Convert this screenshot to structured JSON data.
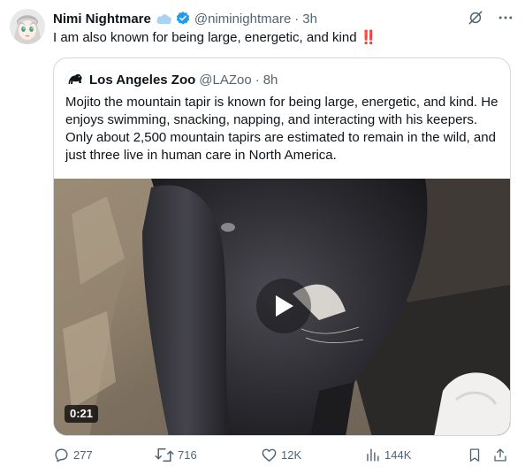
{
  "tweet": {
    "author_name": "Nimi Nightmare",
    "author_handle": "@niminightmare",
    "separator": "·",
    "time": "3h",
    "text": "I am also known for being large, energetic, and kind",
    "emoji": "‼️",
    "icons": {
      "badge": "cloud-icon",
      "verified": "verified-badge-icon",
      "menu": "more-icon",
      "grok": "grok-icon"
    }
  },
  "quote": {
    "author_name": "Los Angeles Zoo",
    "author_handle": "@LAZoo",
    "separator": "·",
    "time": "8h",
    "text": "Mojito the mountain tapir is known for being large, energetic, and kind. He enjoys swimming, snacking, napping, and interacting with his keepers. Only about 2,500 mountain tapirs are estimated to remain in the wild, and just three live in human care in North America.",
    "video": {
      "duration": "0:21"
    }
  },
  "actions": {
    "replies": "277",
    "reposts": "716",
    "likes": "12K",
    "views": "144K"
  },
  "colors": {
    "accent": "#1d9bf0",
    "muted": "#536471",
    "border": "#cfd9de"
  }
}
